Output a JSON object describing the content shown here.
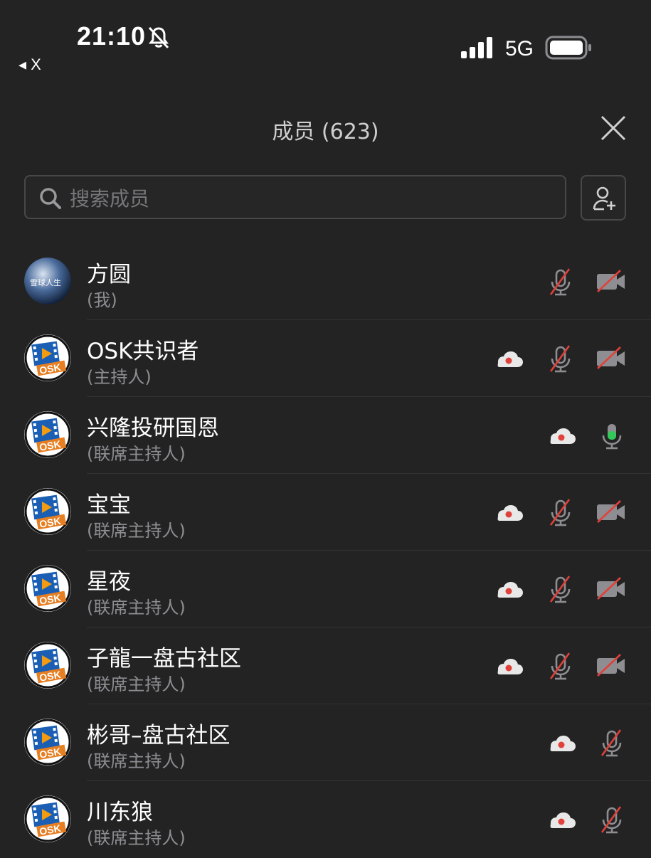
{
  "status_bar": {
    "time": "21:10",
    "back_label": "◂ X",
    "network": "5G"
  },
  "header": {
    "title": "成员 (623)"
  },
  "search": {
    "placeholder": "搜索成员"
  },
  "members": [
    {
      "name": "方圆",
      "role": "(我)",
      "avatar": "snowball-avatar",
      "avatar_text": "雪球人生",
      "cloud": false,
      "mic": "muted",
      "camera": "off"
    },
    {
      "name": "OSK共识者",
      "role": "(主持人)",
      "avatar": "osk-logo",
      "cloud": true,
      "mic": "muted",
      "camera": "off"
    },
    {
      "name": "兴隆投研国恩",
      "role": "(联席主持人)",
      "avatar": "osk-logo",
      "cloud": true,
      "mic": "active",
      "camera": "none"
    },
    {
      "name": "宝宝",
      "role": "(联席主持人)",
      "avatar": "osk-logo",
      "cloud": true,
      "mic": "muted",
      "camera": "off"
    },
    {
      "name": "星夜",
      "role": "(联席主持人)",
      "avatar": "osk-logo",
      "cloud": true,
      "mic": "muted",
      "camera": "off"
    },
    {
      "name": "子龍一盘古社区",
      "role": "(联席主持人)",
      "avatar": "osk-logo",
      "cloud": true,
      "mic": "muted",
      "camera": "off"
    },
    {
      "name": "彬哥–盘古社区",
      "role": "(联席主持人)",
      "avatar": "osk-logo",
      "cloud": true,
      "mic": "muted",
      "camera": "none"
    },
    {
      "name": "川东狼",
      "role": "(联席主持人)",
      "avatar": "osk-logo",
      "cloud": true,
      "mic": "muted",
      "camera": "none"
    }
  ],
  "colors": {
    "background": "#232324",
    "muted_red": "#e0413a",
    "active_green": "#34c759",
    "icon_gray": "#8e8e92"
  }
}
